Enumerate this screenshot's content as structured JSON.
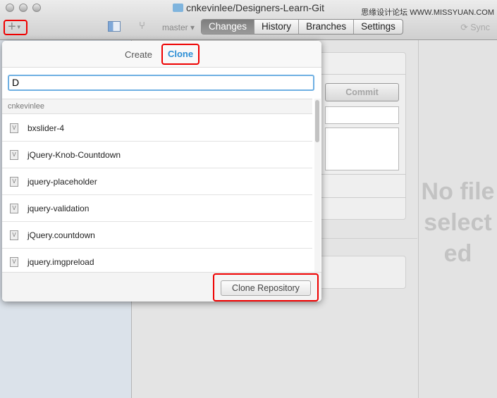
{
  "window": {
    "title": "cnkevinlee/Designers-Learn-Git",
    "watermark": "思缘设计论坛 WWW.MISSYUAN.COM"
  },
  "toolbar": {
    "add_label": "+",
    "branch": "master ▾",
    "tabs": [
      "Changes",
      "History",
      "Branches",
      "Settings"
    ],
    "active_tab": "Changes",
    "sync": "⟳ Sync"
  },
  "changes": {
    "commit_label": "Commit"
  },
  "detail": {
    "empty_text": "No file selected"
  },
  "popover": {
    "tabs": [
      "Create",
      "Clone"
    ],
    "active_tab": "Clone",
    "search_value": "D",
    "section": "cnkevinlee",
    "repos": [
      "bxslider-4",
      "jQuery-Knob-Countdown",
      "jquery-placeholder",
      "jquery-validation",
      "jQuery.countdown",
      "jquery.imgpreload"
    ],
    "clone_button": "Clone Repository"
  },
  "colors": {
    "accent": "#2d8fd5",
    "highlight": "#ee0000"
  }
}
